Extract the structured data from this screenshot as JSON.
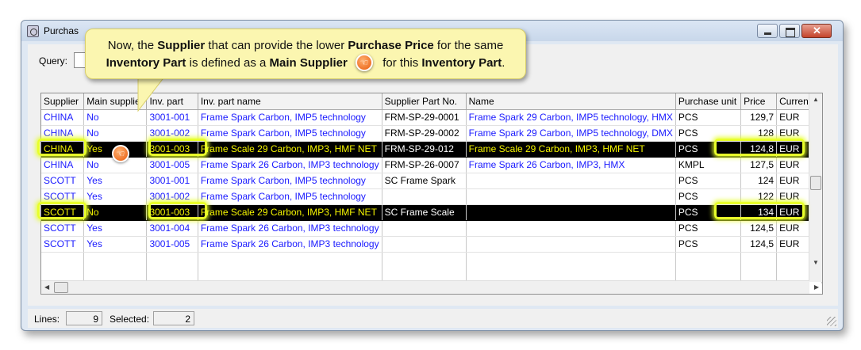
{
  "window": {
    "title": "Purchas"
  },
  "query": {
    "label": "Query:"
  },
  "callout": {
    "t1": "Now, the ",
    "b1": "Supplier",
    "t2": " that can provide the lower ",
    "b2": "Purchase Price",
    "t3": " for the same",
    "b3": "Inventory Part",
    "t4": " is defined as a ",
    "b4": "Main Supplier",
    "t5": " for this ",
    "b5": "Inventory Part",
    "t6": "."
  },
  "columns": [
    "Supplier",
    "Main supplier",
    "Inv. part",
    "Inv. part name",
    "Supplier Part No.",
    "Name",
    "Purchase unit",
    "Price",
    "Currency"
  ],
  "rows": [
    {
      "supplier": "CHINA",
      "main": "No",
      "part": "3001-001",
      "part_name": "Frame Spark Carbon, IMP5 technology",
      "sup_part": "FRM-SP-29-0001",
      "name": "Frame Spark 29 Carbon, IMP5 technology, HMX",
      "unit": "PCS",
      "price": "129,7",
      "currency": "EUR"
    },
    {
      "supplier": "CHINA",
      "main": "No",
      "part": "3001-002",
      "part_name": "Frame Spark Carbon, IMP5 technology",
      "sup_part": "FRM-SP-29-0002",
      "name": "Frame Spark 29 Carbon, IMP5 technology, DMX",
      "unit": "PCS",
      "price": "128",
      "currency": "EUR"
    },
    {
      "supplier": "CHINA",
      "main": "Yes",
      "part": "3001-003",
      "part_name": "Frame Scale 29 Carbon, IMP3, HMF NET",
      "sup_part": "FRM-SP-29-012",
      "name": "Frame Scale 29 Carbon, IMP3, HMF NET",
      "unit": "PCS",
      "price": "124,8",
      "currency": "EUR"
    },
    {
      "supplier": "CHINA",
      "main": "No",
      "part": "3001-005",
      "part_name": "Frame Spark 26 Carbon, IMP3 technology",
      "sup_part": "FRM-SP-26-0007",
      "name": "Frame Spark 26 Carbon, IMP3, HMX",
      "unit": "KMPL",
      "price": "127,5",
      "currency": "EUR"
    },
    {
      "supplier": "SCOTT",
      "main": "Yes",
      "part": "3001-001",
      "part_name": "Frame Spark Carbon, IMP5 technology",
      "sup_part": "SC Frame Spark",
      "name": "",
      "unit": "PCS",
      "price": "124",
      "currency": "EUR"
    },
    {
      "supplier": "SCOTT",
      "main": "Yes",
      "part": "3001-002",
      "part_name": "Frame Spark Carbon, IMP5 technology",
      "sup_part": "",
      "name": "",
      "unit": "PCS",
      "price": "122",
      "currency": "EUR"
    },
    {
      "supplier": "SCOTT",
      "main": "No",
      "part": "3001-003",
      "part_name": "Frame Scale 29 Carbon, IMP3, HMF NET",
      "sup_part": "SC Frame Scale",
      "name": "",
      "unit": "PCS",
      "price": "134",
      "currency": "EUR"
    },
    {
      "supplier": "SCOTT",
      "main": "Yes",
      "part": "3001-004",
      "part_name": "Frame Spark 26 Carbon, IMP3 technology",
      "sup_part": "",
      "name": "",
      "unit": "PCS",
      "price": "124,5",
      "currency": "EUR"
    },
    {
      "supplier": "SCOTT",
      "main": "Yes",
      "part": "3001-005",
      "part_name": "Frame Spark 26 Carbon, IMP3 technology",
      "sup_part": "",
      "name": "",
      "unit": "PCS",
      "price": "124,5",
      "currency": "EUR"
    }
  ],
  "status": {
    "lines_label": "Lines:",
    "lines_value": "9",
    "selected_label": "Selected:",
    "selected_value": "2"
  },
  "icons": {
    "hand": "hand-pointer-icon",
    "app": "app-icon"
  },
  "colors": {
    "link_text": "#1a1aff",
    "selected_bg": "#000000",
    "selected_text": "#f5f500",
    "highlight": "#e8ff2a",
    "callout_bg": "#fbf6b0"
  }
}
